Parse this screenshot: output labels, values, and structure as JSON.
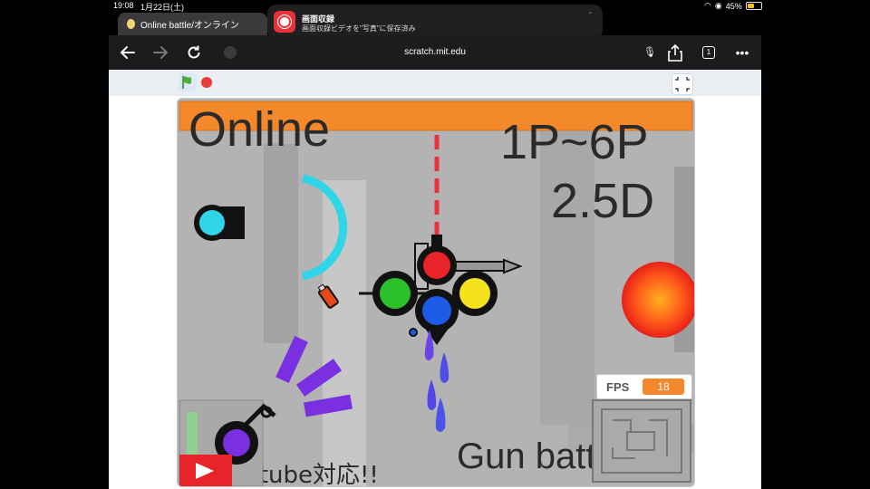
{
  "status_bar": {
    "time": "19:08",
    "date": "1月22日(土)",
    "battery": "45%",
    "battery_level": 0.45
  },
  "tab": {
    "title": "Online battle/オンライン"
  },
  "notification": {
    "title": "画面収録",
    "message": "画面収録ビデオを\"写真\"に保存済み"
  },
  "toolbar": {
    "url": "scratch.mit.edu",
    "tab_count": "1"
  },
  "game": {
    "title_online": "Online",
    "players": "1P~6P",
    "mode": "2.5D",
    "subtitle": "Gun battle",
    "footer": "sctube対応!!",
    "fps_label": "FPS",
    "fps_value": "18"
  },
  "colors": {
    "accent_orange": "#f4892b",
    "stage_bg": "#b8b8b8",
    "record_red": "#e8323a"
  }
}
